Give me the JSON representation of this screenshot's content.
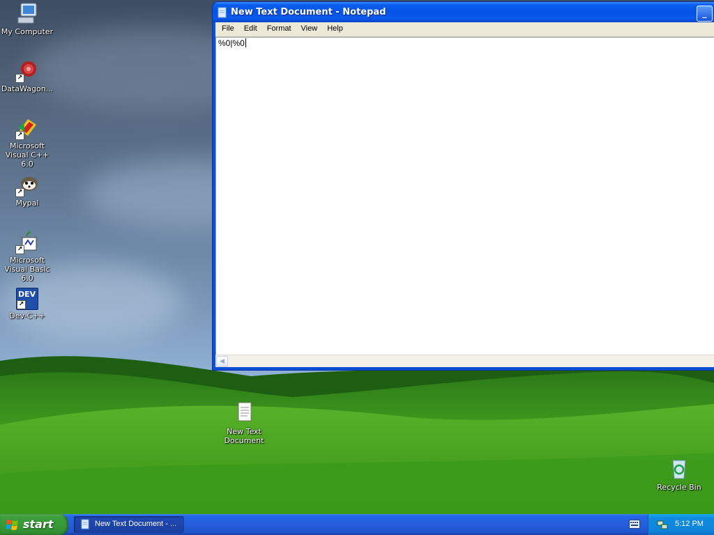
{
  "desktop": {
    "icons": [
      {
        "label": "My Computer",
        "icon": "my-computer-icon"
      },
      {
        "label": "DataWagon...",
        "icon": "datawagon-icon"
      },
      {
        "label": "Microsoft Visual C++ 6.0",
        "icon": "visual-cpp-icon"
      },
      {
        "label": "Mypal",
        "icon": "mypal-icon"
      },
      {
        "label": "Microsoft Visual Basic 6.0",
        "icon": "visual-basic-icon"
      },
      {
        "label": "Dev-C++",
        "icon": "dev-cpp-icon"
      },
      {
        "label": "New Text Document",
        "icon": "text-document-icon"
      },
      {
        "label": "Recycle Bin",
        "icon": "recycle-bin-icon"
      }
    ],
    "dev_badge": "DEV"
  },
  "notepad": {
    "title": "New Text Document - Notepad",
    "menu": [
      "File",
      "Edit",
      "Format",
      "View",
      "Help"
    ],
    "content": "%0|%0",
    "minimize_glyph": "_"
  },
  "taskbar": {
    "start_label": "start",
    "task_button": "New Text Document - ...",
    "clock": "5:12 PM"
  }
}
